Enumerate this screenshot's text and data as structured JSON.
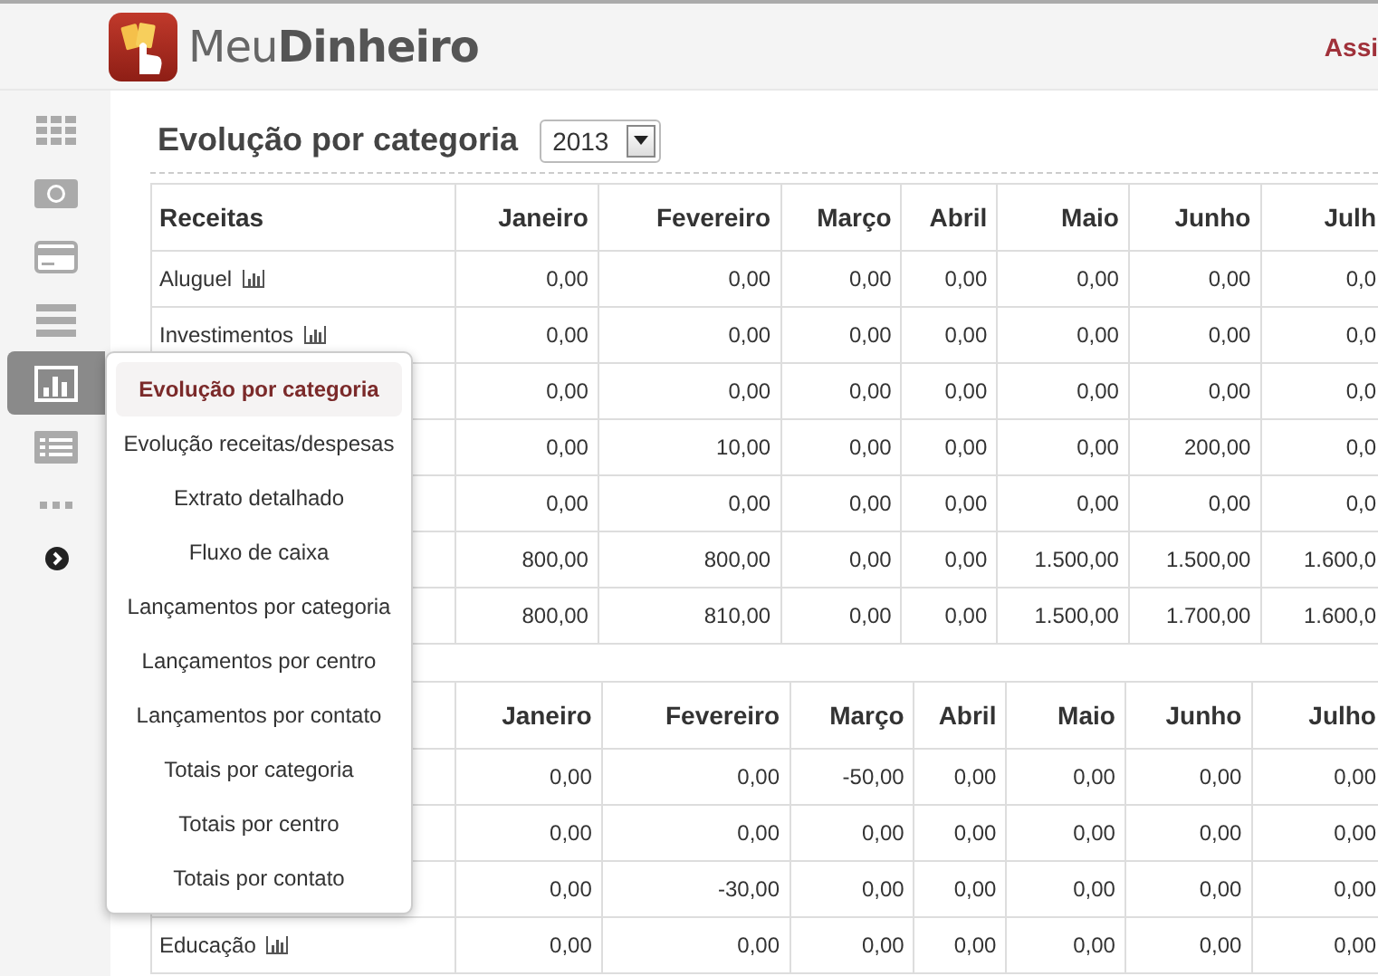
{
  "header": {
    "logo": "Meu**Dinheiro**",
    "link": "Assi"
  },
  "sidebar": {
    "items": [
      {
        "kind": "grid",
        "selected": false
      },
      {
        "kind": "banknote",
        "selected": false
      },
      {
        "kind": "card",
        "selected": false
      },
      {
        "kind": "rows",
        "selected": false
      },
      {
        "kind": "chart",
        "selected": true
      },
      {
        "kind": "list",
        "selected": false
      },
      {
        "kind": "dots",
        "selected": false
      },
      {
        "kind": "chevron",
        "selected": false
      }
    ]
  },
  "report": {
    "title": "Evolução por categoria",
    "year": "2013"
  },
  "tables": [
    {
      "heading": "Receitas",
      "columns": [
        "Janeiro",
        "Fevereiro",
        "Março",
        "Abril",
        "Maio",
        "Junho",
        "Julh"
      ],
      "rows": [
        {
          "label": "Aluguel",
          "cells": [
            "0,00",
            "0,00",
            "0,00",
            "0,00",
            "0,00",
            "0,00",
            "0,0"
          ]
        },
        {
          "label": "Investimentos",
          "cells": [
            "0,00",
            "0,00",
            "0,00",
            "0,00",
            "0,00",
            "0,00",
            "0,0"
          ]
        },
        {
          "cells": [
            "0,00",
            "0,00",
            "0,00",
            "0,00",
            "0,00",
            "0,00",
            "0,0"
          ]
        },
        {
          "cells": [
            "0,00",
            "10,00",
            "0,00",
            "0,00",
            "0,00",
            "200,00",
            "0,0"
          ]
        },
        {
          "cells": [
            "0,00",
            "0,00",
            "0,00",
            "0,00",
            "0,00",
            "0,00",
            "0,0"
          ]
        },
        {
          "cells": [
            "800,00",
            "800,00",
            "0,00",
            "0,00",
            "1.500,00",
            "1.500,00",
            "1.600,0"
          ]
        },
        {
          "cells": [
            "800,00",
            "810,00",
            "0,00",
            "0,00",
            "1.500,00",
            "1.700,00",
            "1.600,0"
          ]
        }
      ]
    },
    {
      "columns": [
        "Janeiro",
        "Fevereiro",
        "Março",
        "Abril",
        "Maio",
        "Junho",
        "Julho"
      ],
      "rows": [
        {
          "cells": [
            "0,00",
            "0,00",
            "-50,00",
            "0,00",
            "0,00",
            "0,00",
            "0,00"
          ]
        },
        {
          "cells": [
            "0,00",
            "0,00",
            "0,00",
            "0,00",
            "0,00",
            "0,00",
            "0,00"
          ]
        },
        {
          "cells": [
            "0,00",
            "-30,00",
            "0,00",
            "0,00",
            "0,00",
            "0,00",
            "0,00"
          ]
        },
        {
          "label": "Educação",
          "cells": [
            "0,00",
            "0,00",
            "0,00",
            "0,00",
            "0,00",
            "0,00",
            "0,00"
          ]
        }
      ]
    }
  ],
  "menu": {
    "items": [
      {
        "label": "Evolução por categoria",
        "selected": true
      },
      {
        "label": "Evolução receitas/despesas",
        "selected": false
      },
      {
        "label": "Extrato detalhado",
        "selected": false
      },
      {
        "label": "Fluxo de caixa",
        "selected": false
      },
      {
        "label": "Lançamentos por categoria",
        "selected": false
      },
      {
        "label": "Lançamentos por centro",
        "selected": false
      },
      {
        "label": "Lançamentos por contato",
        "selected": false
      },
      {
        "label": "Totais por categoria",
        "selected": false
      },
      {
        "label": "Totais por centro",
        "selected": false
      },
      {
        "label": "Totais por contato",
        "selected": false
      }
    ]
  }
}
